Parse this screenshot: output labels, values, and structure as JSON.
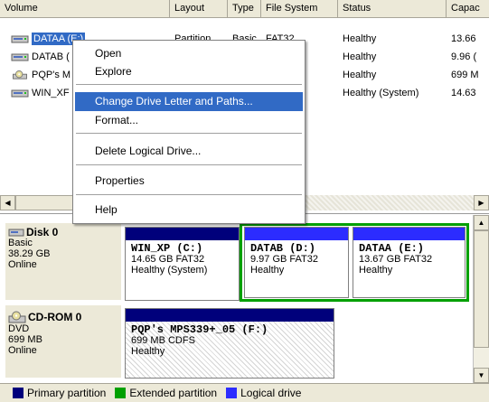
{
  "colors": {
    "primary_partition": "#00007b",
    "extended_partition": "#00a000",
    "logical_drive": "#2c2cff",
    "selection": "#316ac5"
  },
  "columns": {
    "volume": "Volume",
    "layout": "Layout",
    "type": "Type",
    "filesystem": "File System",
    "status": "Status",
    "capacity": "Capac"
  },
  "rows": [
    {
      "icon": "drive-icon",
      "volume": "DATAA (E:)",
      "layout": "Partition",
      "type": "Basic",
      "filesystem": "FAT32",
      "status": "Healthy",
      "capacity": "13.66"
    },
    {
      "icon": "drive-icon",
      "volume": "DATAB (",
      "layout": "",
      "type": "",
      "filesystem": "2",
      "status": "Healthy",
      "capacity": "9.96 ("
    },
    {
      "icon": "cd-drive-icon",
      "volume": "PQP's M",
      "layout": "",
      "type": "",
      "filesystem": "",
      "status": "Healthy",
      "capacity": "699 M"
    },
    {
      "icon": "drive-icon",
      "volume": "WIN_XF",
      "layout": "",
      "type": "",
      "filesystem": "2",
      "status": "Healthy (System)",
      "capacity": "14.63"
    }
  ],
  "context_menu": {
    "open": "Open",
    "explore": "Explore",
    "change_letter": "Change Drive Letter and Paths...",
    "format": "Format...",
    "delete": "Delete Logical Drive...",
    "properties": "Properties",
    "help": "Help"
  },
  "disks": {
    "disk0": {
      "name": "Disk 0",
      "type": "Basic",
      "size": "38.29 GB",
      "state": "Online",
      "partitions": [
        {
          "name": "WIN_XP  (C:)",
          "size": "14.65 GB FAT32",
          "status": "Healthy (System)"
        },
        {
          "name": "DATAB  (D:)",
          "size": "9.97 GB FAT32",
          "status": "Healthy"
        },
        {
          "name": "DATAA  (E:)",
          "size": "13.67 GB FAT32",
          "status": "Healthy"
        }
      ]
    },
    "cdrom0": {
      "name": "CD-ROM 0",
      "type": "DVD",
      "size": "699 MB",
      "state": "Online",
      "partitions": [
        {
          "name": "PQP's MPS339+_05  (F:)",
          "size": "699 MB CDFS",
          "status": "Healthy"
        }
      ]
    }
  },
  "legend": {
    "primary": "Primary partition",
    "extended": "Extended partition",
    "logical": "Logical drive"
  }
}
